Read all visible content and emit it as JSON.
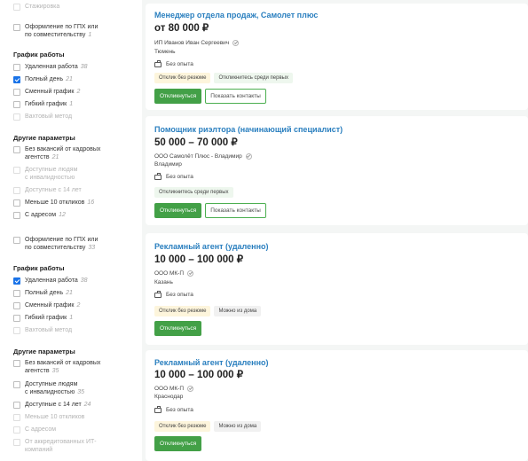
{
  "filters": {
    "top_partial": {
      "label": "Стажировка"
    },
    "group1": {
      "gph": {
        "line1": "Оформление по ГПХ или",
        "line2": "по совместительству",
        "count": "1"
      },
      "schedule_title": "График работы",
      "schedule": [
        {
          "label": "Удаленная работа",
          "count": "38",
          "checked": false
        },
        {
          "label": "Полный день",
          "count": "21",
          "checked": true
        },
        {
          "label": "Сменный график",
          "count": "2",
          "checked": false
        },
        {
          "label": "Гибкий график",
          "count": "1",
          "checked": false
        },
        {
          "label": "Вахтовый метод",
          "count": "",
          "checked": false
        }
      ],
      "other_title": "Другие параметры",
      "other": [
        {
          "line1": "Без вакансий от кадровых",
          "line2": "агентств",
          "count": "21"
        },
        {
          "line1": "Доступные людям",
          "line2": "с инвалидностью",
          "count": ""
        },
        {
          "line1": "Доступные с 14 лет",
          "line2": "",
          "count": ""
        },
        {
          "line1": "Меньше 10 откликов",
          "line2": "",
          "count": "16"
        },
        {
          "line1": "С адресом",
          "line2": "",
          "count": "12"
        }
      ]
    },
    "group2": {
      "gph": {
        "line1": "Оформление по ГПХ или",
        "line2": "по совместительству",
        "count": "33"
      },
      "schedule_title": "График работы",
      "schedule": [
        {
          "label": "Удаленная работа",
          "count": "38",
          "checked": true
        },
        {
          "label": "Полный день",
          "count": "21",
          "checked": false
        },
        {
          "label": "Сменный график",
          "count": "2",
          "checked": false
        },
        {
          "label": "Гибкий график",
          "count": "1",
          "checked": false
        },
        {
          "label": "Вахтовый метод",
          "count": "",
          "checked": false
        }
      ],
      "other_title": "Другие параметры",
      "other": [
        {
          "line1": "Без вакансий от кадровых",
          "line2": "агентств",
          "count": "35"
        },
        {
          "line1": "Доступные людям",
          "line2": "с инвалидностью",
          "count": "35"
        },
        {
          "line1": "Доступные с 14 лет",
          "line2": "",
          "count": "24"
        },
        {
          "line1": "Меньше 10 откликов",
          "line2": "",
          "count": ""
        },
        {
          "line1": "С адресом",
          "line2": "",
          "count": ""
        },
        {
          "line1": "От аккредитованных ИТ-",
          "line2": "компаний",
          "count": ""
        }
      ]
    }
  },
  "vacancies": [
    {
      "title": "Менеджер отдела продаж, Самолет плюс",
      "salary": "от 80 000 ₽",
      "company": "ИП Иванов Иван Сергеевич",
      "city": "Тюмень",
      "experience": "Без опыта",
      "tags": [
        "Отклик без резюме",
        "Откликнитесь среди первых"
      ],
      "apply_label": "Откликнуться",
      "contacts_label": "Показать контакты"
    },
    {
      "title": "Помощник риэлтора (начинающий специалист)",
      "salary": "50 000 – 70 000 ₽",
      "company": "ООО Самолёт Плюс - Владимир",
      "city": "Владимир",
      "experience": "Без опыта",
      "tags": [
        "Откликнитесь среди первых"
      ],
      "apply_label": "Откликнуться",
      "contacts_label": "Показать контакты"
    },
    {
      "title": "Рекламный агент (удаленно)",
      "salary": "10 000 – 100 000 ₽",
      "company": "ООО МК-П",
      "city": "Казань",
      "experience": "Без опыта",
      "tags": [
        "Отклик без резюме",
        "Можно из дома"
      ],
      "apply_label": "Откликнуться"
    },
    {
      "title": "Рекламный агент (удаленно)",
      "salary": "10 000 – 100 000 ₽",
      "company": "ООО МК-П",
      "city": "Краснодар",
      "experience": "Без опыта",
      "tags": [
        "Отклик без резюме",
        "Можно из дома"
      ],
      "apply_label": "Откликнуться"
    }
  ]
}
